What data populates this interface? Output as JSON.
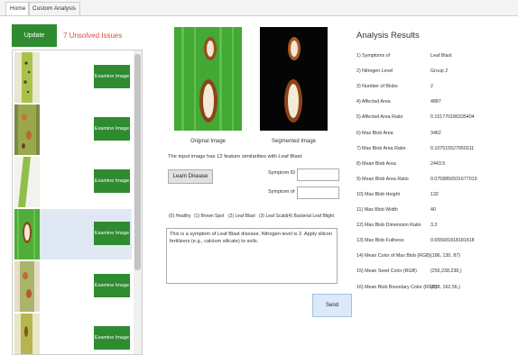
{
  "tabs": [
    {
      "label": "Home"
    },
    {
      "label": "Custom Analysis"
    }
  ],
  "update_button": "Update",
  "unsolved_issues": "7 Unsolved Issues",
  "list_items": [
    {
      "button": "Examine Image",
      "selected": false
    },
    {
      "button": "Examine Image",
      "selected": false
    },
    {
      "button": "Examine Image",
      "selected": false
    },
    {
      "button": "Examine Image",
      "selected": true
    },
    {
      "button": "Examine Image",
      "selected": false
    },
    {
      "button": "Examine Image",
      "selected": false
    }
  ],
  "original_image_caption": "Original Image",
  "segmented_image_caption": "Segmented Image",
  "similarity_text": "The input image has 12 feature similarities with Leaf Blast",
  "learn_button": "Learn Disease",
  "symptom_id_label": "Symptom ID",
  "symptom_of_label": "Symptom of",
  "symptom_id_value": "",
  "symptom_of_value": "",
  "class_legend": [
    "(0) Healthy",
    "(1) Brown Spot",
    "(2) Leaf Blast",
    "(3) Leaf Scald",
    "(4) Bacterial Leaf Blight"
  ],
  "result_text": "This is a symptom of Leaf Blast disease. Nitrogen level is 2. Apply silicon fertilizers (e.g., calcium silicate) to soils.",
  "send_button": "Send",
  "analysis": {
    "title": "Analysis Results",
    "rows": [
      {
        "label": "1) Symptoms of",
        "value": "Leaf Blast"
      },
      {
        "label": "2) Nitrogen Level",
        "value": "Group 2"
      },
      {
        "label": "3) Number of Blobs",
        "value": "2"
      },
      {
        "label": "4) Affected Area",
        "value": "4887"
      },
      {
        "label": "5) Affected Area Ratio",
        "value": "0.151770186335404"
      },
      {
        "label": "6) Max Blob Area",
        "value": "3462"
      },
      {
        "label": "7) Max Blob Area Ratio",
        "value": "0.107515527950311"
      },
      {
        "label": "8) Mean Blob Area",
        "value": "2443.5"
      },
      {
        "label": "9) Mean Blob Area Ratio",
        "value": "0.0758850931677019"
      },
      {
        "label": "10) Max Blob Height",
        "value": "132"
      },
      {
        "label": "11) Max Blob Width",
        "value": "40"
      },
      {
        "label": "12) Max Blob Dimension Ratio",
        "value": "3.3"
      },
      {
        "label": "13) Max Blob Fullness",
        "value": "0.655681818181818"
      },
      {
        "label": "14) Mean Color of Max Blob (RGB)",
        "value": "(186, 130, 87)"
      },
      {
        "label": "15) Mean Seed Color (RGB)",
        "value": "(255,238,238,)"
      },
      {
        "label": "16) Mean Blob Boundary Color (RGB)",
        "value": "(238, 162,56,)"
      }
    ]
  },
  "colors": {
    "accent_green": "#2e8b30",
    "issues_red": "#e8463b",
    "send_blue": "#dbe9f8"
  }
}
